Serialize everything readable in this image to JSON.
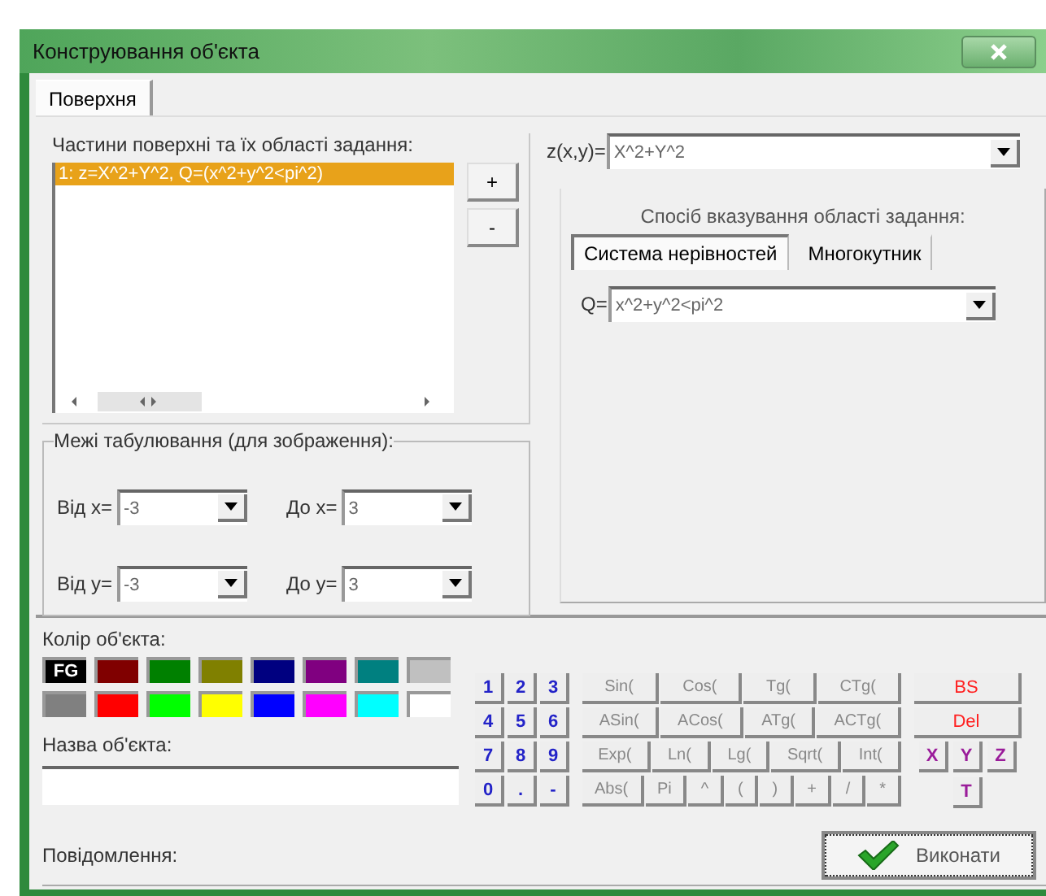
{
  "window": {
    "title": "Конструювання об'єкта"
  },
  "tabs": [
    {
      "label": "Поверхня",
      "selected": true
    }
  ],
  "parts": {
    "label": "Частини поверхні та їх області задання:",
    "items": [
      {
        "text": "1: z=X^2+Y^2, Q=(x^2+y^2<pi^2)",
        "selected": true
      }
    ],
    "add": "+",
    "remove": "-"
  },
  "limits": {
    "label": "Межі табулювання (для зображення):",
    "fields": [
      {
        "label": "Від x=",
        "value": "-3"
      },
      {
        "label": "До x=",
        "value": "3"
      },
      {
        "label": "Від y=",
        "value": "-3"
      },
      {
        "label": "До y=",
        "value": "3"
      }
    ]
  },
  "function": {
    "label": "z(x,y)=",
    "value": "X^2+Y^2"
  },
  "domain": {
    "label": "Спосіб вказування області задання:",
    "tabs": [
      {
        "label": "Система нерівностей",
        "selected": true
      },
      {
        "label": "Многокутник",
        "selected": false
      }
    ],
    "q_label": "Q=",
    "q_value": "x^2+y^2<pi^2"
  },
  "colors": {
    "label": "Колір об'єкта:",
    "swatches": [
      {
        "color": "#000000",
        "text": "FG"
      },
      {
        "color": "#800000"
      },
      {
        "color": "#008000"
      },
      {
        "color": "#808000"
      },
      {
        "color": "#000080"
      },
      {
        "color": "#800080"
      },
      {
        "color": "#008080"
      },
      {
        "color": "#c0c0c0"
      },
      {
        "color": "#808080"
      },
      {
        "color": "#ff0000"
      },
      {
        "color": "#00ff00"
      },
      {
        "color": "#ffff00"
      },
      {
        "color": "#0000ff"
      },
      {
        "color": "#ff00ff"
      },
      {
        "color": "#00ffff"
      },
      {
        "color": "#ffffff"
      }
    ]
  },
  "name": {
    "label": "Назва об'єкта:"
  },
  "keypad": {
    "digits": [
      "1",
      "2",
      "3",
      "4",
      "5",
      "6",
      "7",
      "8",
      "9",
      "0",
      ".",
      "-"
    ],
    "functions": [
      [
        "Sin(",
        "Cos(",
        "Tg(",
        "CTg("
      ],
      [
        "ASin(",
        "ACos(",
        "ATg(",
        "ACTg("
      ],
      [
        "Exp(",
        "Ln(",
        "Lg(",
        "Sqrt(",
        "Int("
      ],
      [
        "Abs(",
        "Pi",
        "^",
        "(",
        ")",
        "+",
        "/",
        "*"
      ]
    ],
    "edit": [
      "BS",
      "Del"
    ],
    "variables": [
      "X",
      "Y",
      "Z",
      "T"
    ]
  },
  "status_bar": {
    "label": "Повідомлення:"
  },
  "run_button": "Виконати"
}
